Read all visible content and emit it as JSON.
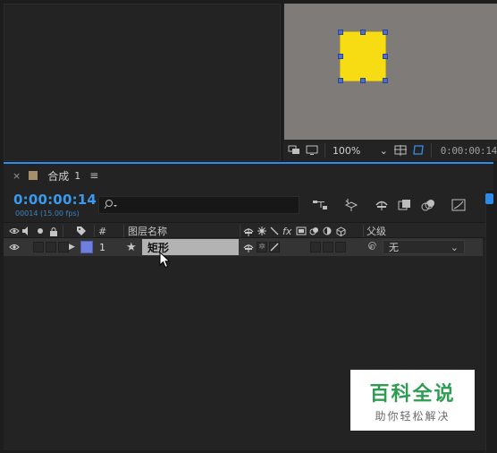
{
  "viewer": {
    "zoom": "100%",
    "timecode": "0:00:00:14"
  },
  "timeline": {
    "tab_close": "×",
    "tab_label": "合成",
    "tab_number": "1",
    "tab_menu": "≡",
    "timecode": "0:00:00:14",
    "frame_info": "00014 (15.00 fps)",
    "search_icon": "⌕",
    "columns": {
      "number": "#",
      "layer_name": "图层名称",
      "parent": "父级"
    },
    "layer": {
      "index": "1",
      "name": "矩形",
      "parent": "无",
      "label_color": "#6f7fde"
    }
  },
  "watermark": {
    "title": "百科全说",
    "subtitle": "助你轻松解决"
  },
  "colors": {
    "accent": "#2d8ceb",
    "solid": "#f7dc13",
    "watermark_green": "#2e9d52"
  }
}
